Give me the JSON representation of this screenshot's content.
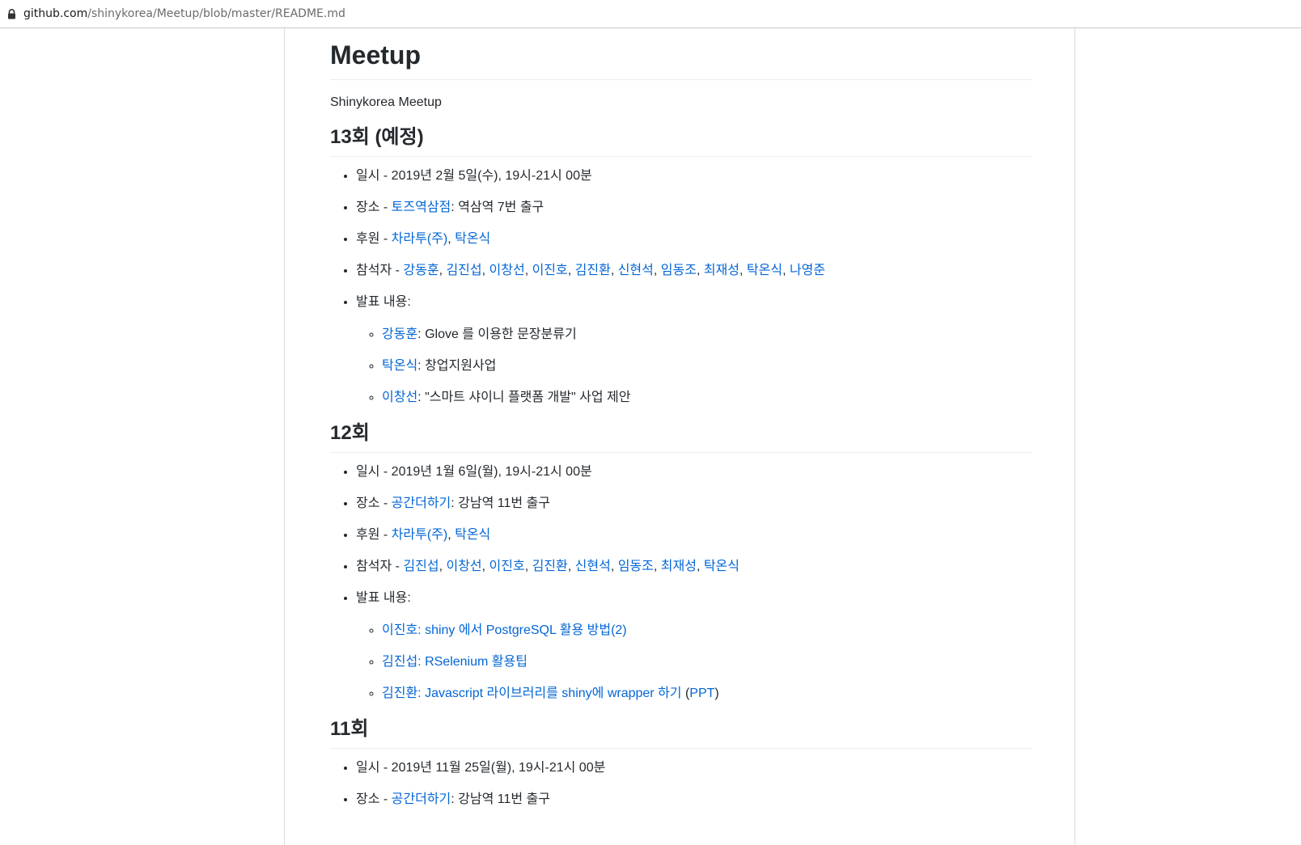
{
  "browser": {
    "url_host": "github.com",
    "url_path": "/shinykorea/Meetup/blob/master/README.md"
  },
  "readme": {
    "title": "Meetup",
    "description": "Shinykorea Meetup",
    "sections": [
      {
        "heading": "13회 (예정)",
        "date_label": "일시 - ",
        "date_value": "2019년 2월 5일(수), 19시-21시 00분",
        "place_label": "장소 - ",
        "place_link": "토즈역삼점",
        "place_rest": ": 역삼역 7번 출구",
        "sponsor_label": "후원 - ",
        "sponsors": [
          "차라투(주)",
          "탁온식"
        ],
        "attendee_label": "참석자 - ",
        "attendees": [
          "강동훈",
          "김진섭",
          "이창선",
          "이진호",
          "김진환",
          "신현석",
          "임동조",
          "최재성",
          "탁온식",
          "나영준"
        ],
        "talks_label": "발표 내용:",
        "talks": [
          {
            "speaker": "강동훈",
            "sep": ": ",
            "title": "Glove 를 이용한 문장분류기",
            "title_is_link": false
          },
          {
            "speaker": "탁온식",
            "sep": ": ",
            "title": "창업지원사업",
            "title_is_link": false
          },
          {
            "speaker": "이창선",
            "sep": ": ",
            "title": "\"스마트 샤이니 플랫폼 개발\" 사업 제안",
            "title_is_link": false
          }
        ]
      },
      {
        "heading": "12회",
        "date_label": "일시 - ",
        "date_value": "2019년 1월 6일(월), 19시-21시 00분",
        "place_label": "장소 - ",
        "place_link": "공간더하기",
        "place_rest": ": 강남역 11번 출구",
        "sponsor_label": "후원 - ",
        "sponsors": [
          "차라투(주)",
          "탁온식"
        ],
        "attendee_label": "참석자 - ",
        "attendees": [
          "김진섭",
          "이창선",
          "이진호",
          "김진환",
          "신현석",
          "임동조",
          "최재성",
          "탁온식"
        ],
        "talks_label": "발표 내용:",
        "talks": [
          {
            "speaker": "이진호",
            "sep": ": ",
            "title": "shiny 에서 PostgreSQL 활용 방법(2)",
            "title_is_link": true
          },
          {
            "speaker": "김진섭",
            "sep": ": ",
            "title": "RSelenium 활용팁",
            "title_is_link": true
          },
          {
            "speaker": "김진환",
            "sep": ": ",
            "title": "Javascript 라이브러리를 shiny에 wrapper 하기",
            "title_is_link": true,
            "extra_prefix": " (",
            "extra_link": "PPT",
            "extra_suffix": ")"
          }
        ]
      },
      {
        "heading": "11회",
        "date_label": "일시 - ",
        "date_value": "2019년 11월 25일(월), 19시-21시 00분",
        "place_label": "장소 - ",
        "place_link": "공간더하기",
        "place_rest": ": 강남역 11번 출구"
      }
    ]
  },
  "colors": {
    "link": "#0366d6",
    "text": "#24292e",
    "rule": "#eaecef"
  }
}
